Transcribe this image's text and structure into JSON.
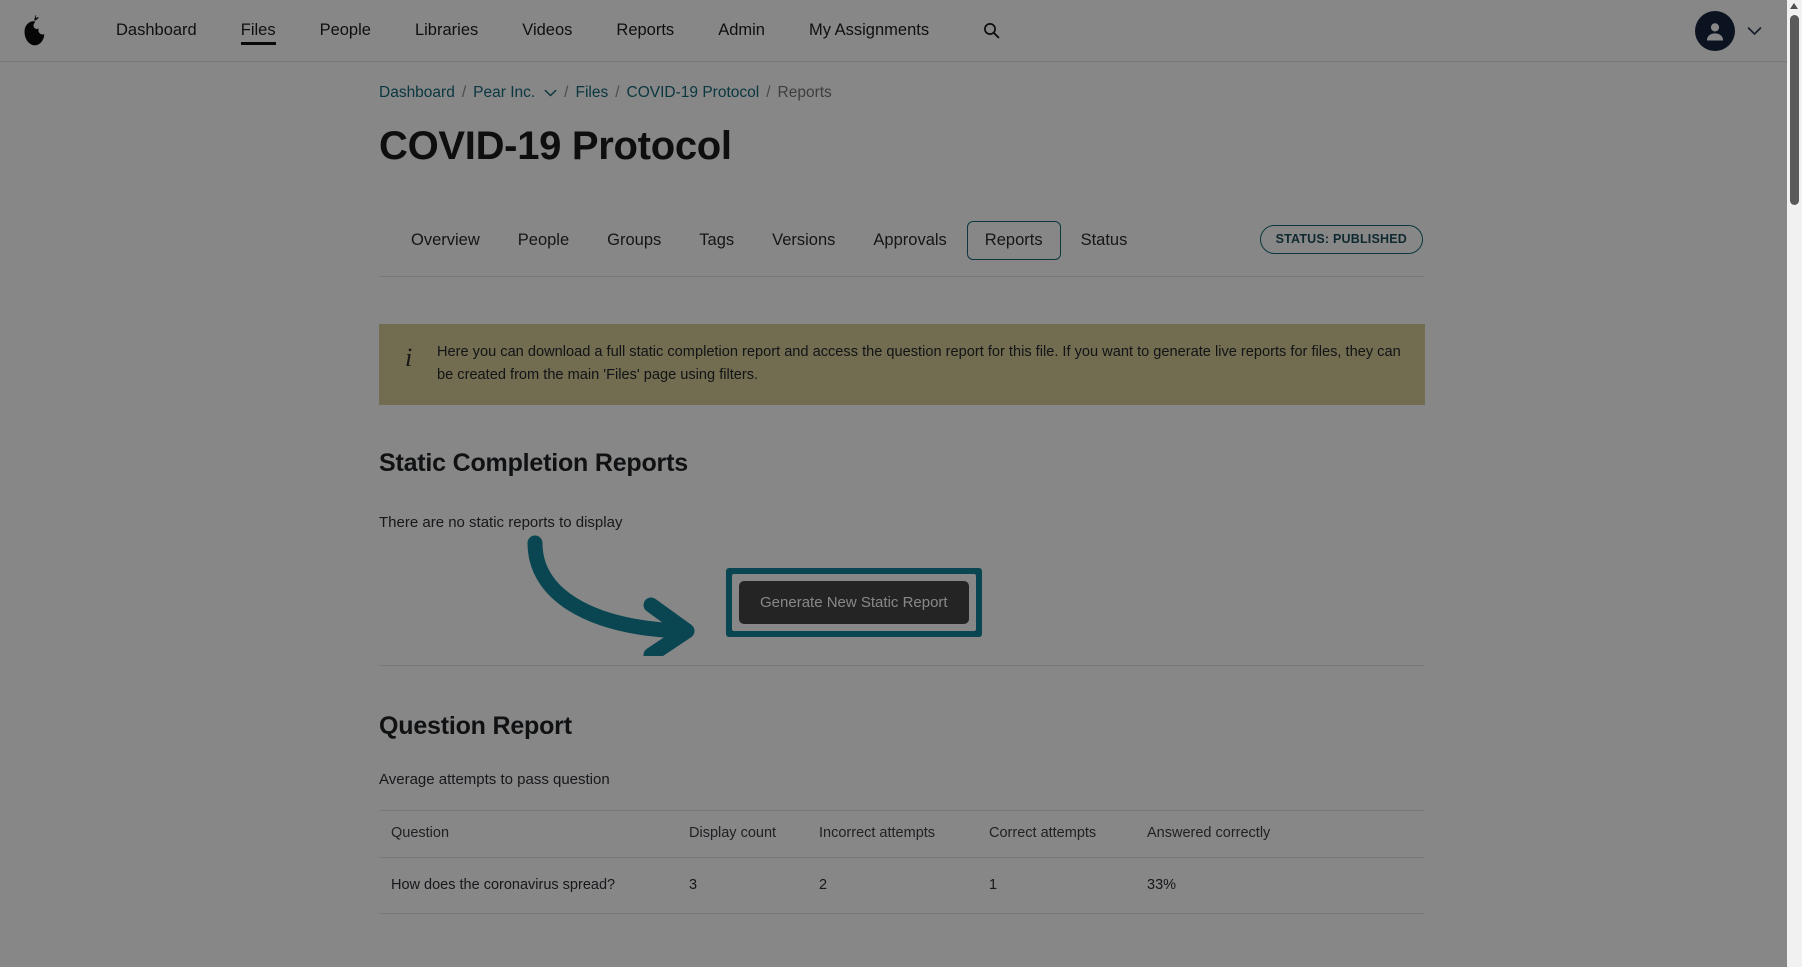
{
  "topnav": {
    "logo_name": "pear-logo",
    "items": [
      {
        "label": "Dashboard",
        "active": false
      },
      {
        "label": "Files",
        "active": true
      },
      {
        "label": "People",
        "active": false
      },
      {
        "label": "Libraries",
        "active": false
      },
      {
        "label": "Videos",
        "active": false
      },
      {
        "label": "Reports",
        "active": false
      },
      {
        "label": "Admin",
        "active": false
      },
      {
        "label": "My Assignments",
        "active": false
      }
    ],
    "search_icon": "search-icon",
    "avatar_icon": "user-avatar-icon",
    "account_caret": "chevron-down-icon"
  },
  "breadcrumb": {
    "items": [
      {
        "label": "Dashboard",
        "type": "link"
      },
      {
        "label": "Pear Inc.",
        "type": "link-dropdown"
      },
      {
        "label": "Files",
        "type": "link"
      },
      {
        "label": "COVID-19 Protocol",
        "type": "link"
      },
      {
        "label": "Reports",
        "type": "current"
      }
    ],
    "separator": "/"
  },
  "page": {
    "title": "COVID-19 Protocol"
  },
  "tabs": {
    "items": [
      {
        "label": "Overview",
        "active": false
      },
      {
        "label": "People",
        "active": false
      },
      {
        "label": "Groups",
        "active": false
      },
      {
        "label": "Tags",
        "active": false
      },
      {
        "label": "Versions",
        "active": false
      },
      {
        "label": "Approvals",
        "active": false
      },
      {
        "label": "Reports",
        "active": true
      },
      {
        "label": "Status",
        "active": false
      }
    ],
    "status_badge": "STATUS: PUBLISHED"
  },
  "info_banner": {
    "icon": "info-icon",
    "text": "Here you can download a full static completion report and access the question report for this file. If you want to generate live reports for files, they can be created from the main 'Files' page using filters."
  },
  "static_reports": {
    "heading": "Static Completion Reports",
    "empty_text": "There are no static reports to display",
    "generate_button": "Generate New Static Report"
  },
  "question_report": {
    "heading": "Question Report",
    "subtitle": "Average attempts to pass question",
    "columns": [
      "Question",
      "Display count",
      "Incorrect attempts",
      "Correct attempts",
      "Answered correctly"
    ],
    "rows": [
      {
        "question": "How does the coronavirus spread?",
        "display_count": "3",
        "incorrect_attempts": "2",
        "correct_attempts": "1",
        "answered_correctly": "33%"
      }
    ]
  },
  "annotation": {
    "arrow": "curved-arrow-annotation",
    "highlight_color": "#118599",
    "arrow_color": "#118599"
  },
  "colors": {
    "accent_teal": "#14697a",
    "banner_olive": "#d8cf9a",
    "button_dark": "#454545",
    "avatar_navy": "#16243d"
  }
}
